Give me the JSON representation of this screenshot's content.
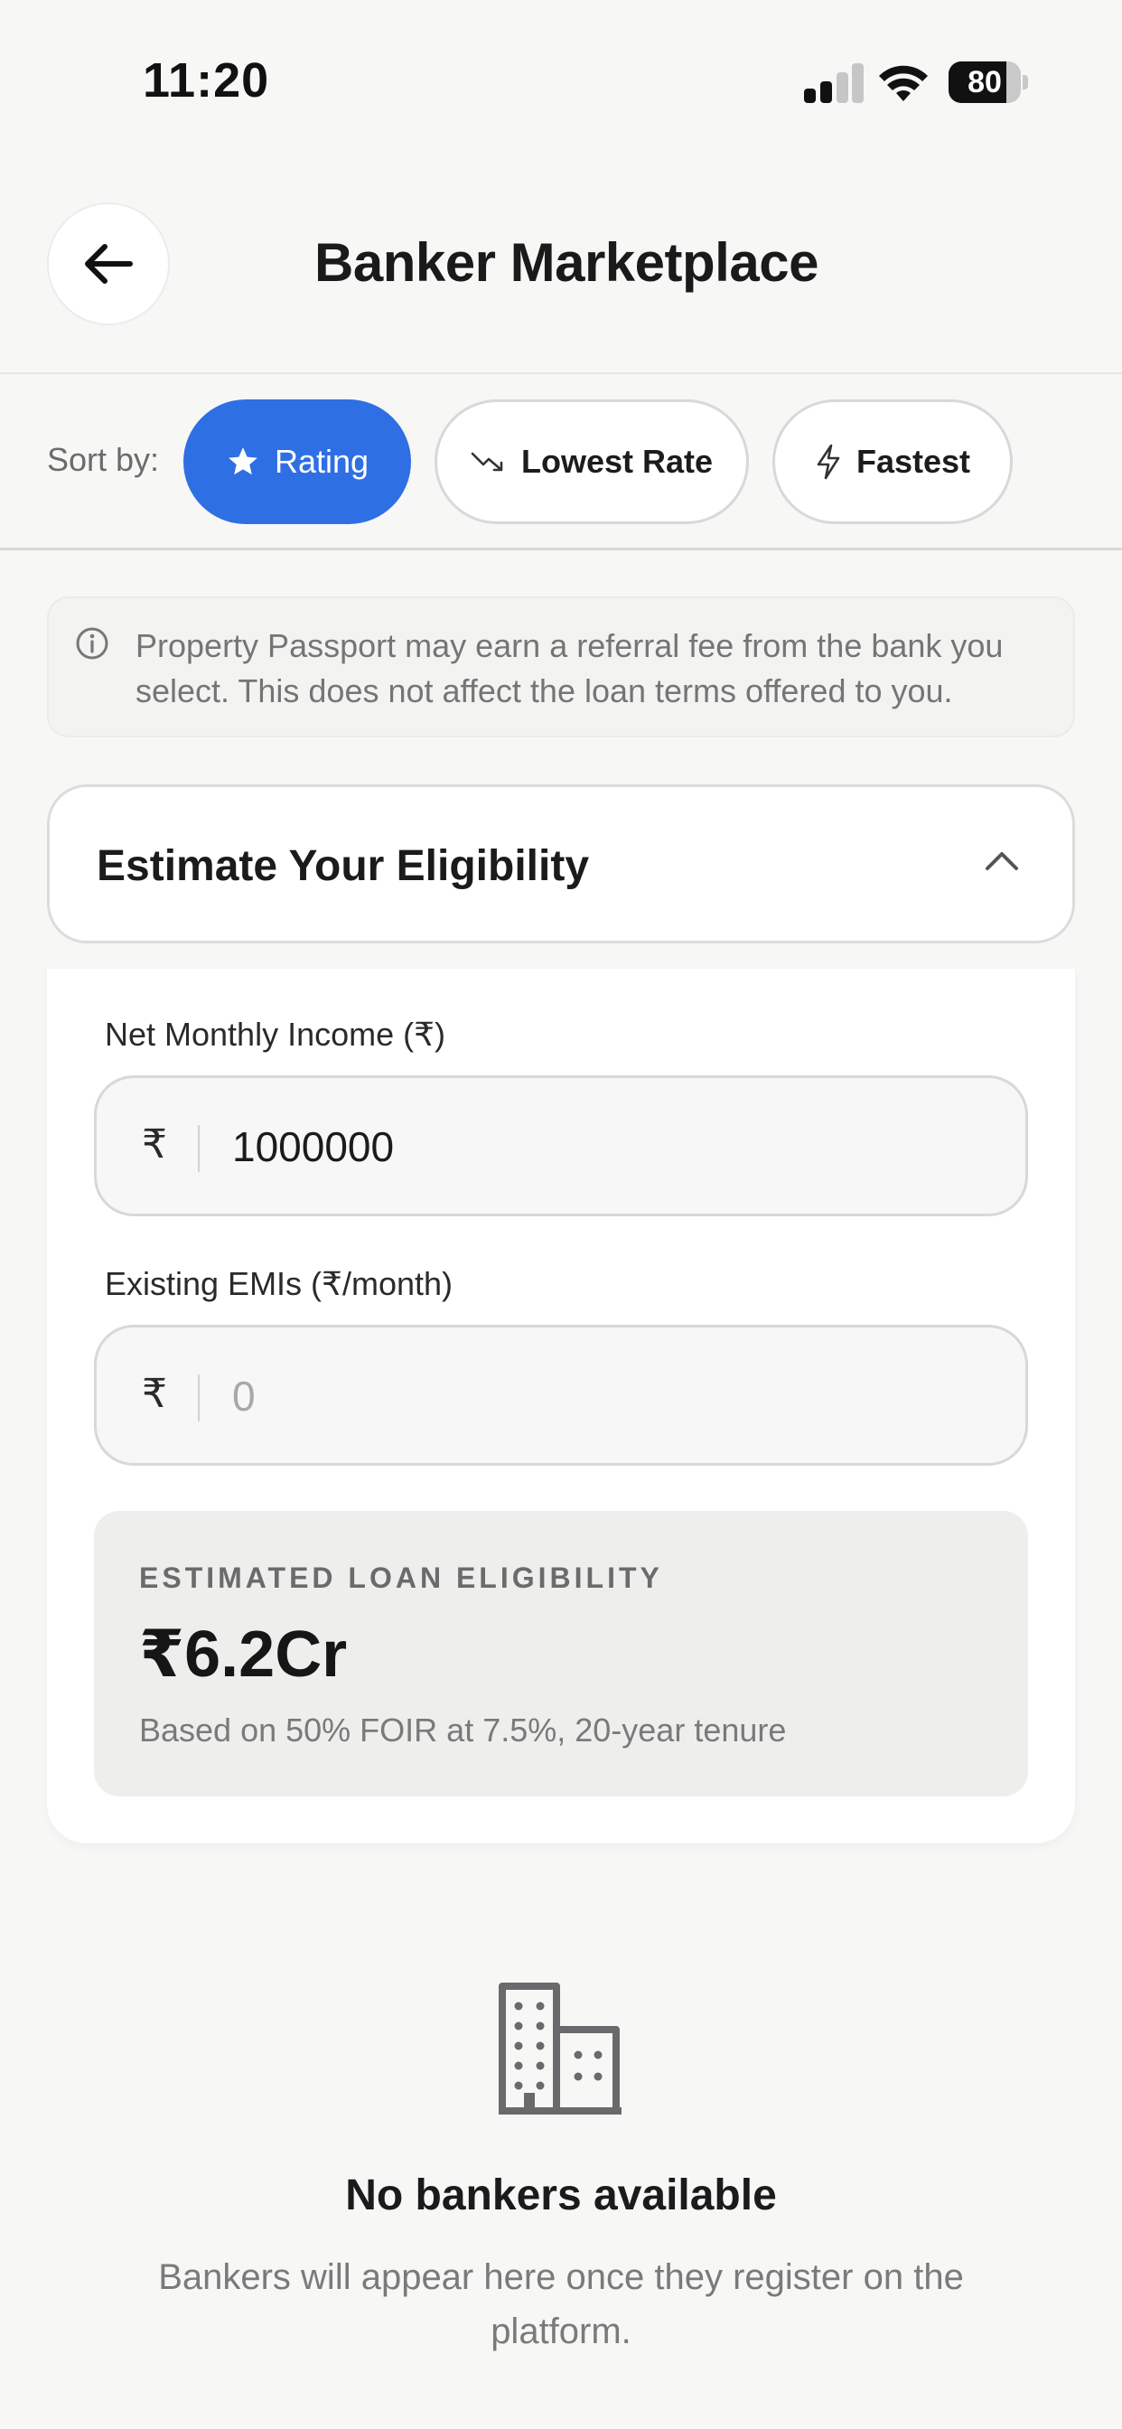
{
  "status_bar": {
    "time": "11:20",
    "battery": "80",
    "battery_level": 0.8
  },
  "header": {
    "title": "Banker Marketplace",
    "back_icon": "arrow-left-icon"
  },
  "sort": {
    "label": "Sort by:",
    "options": [
      {
        "label": "Rating",
        "icon": "star-icon",
        "active": true
      },
      {
        "label": "Lowest Rate",
        "icon": "trending-down-icon",
        "active": false
      },
      {
        "label": "Fastest",
        "icon": "lightning-icon",
        "active": false
      }
    ]
  },
  "disclaimer": {
    "icon": "info-icon",
    "text": "Property Passport may earn a referral fee from the bank you select. This does not affect the loan terms offered to you."
  },
  "eligibility": {
    "title": "Estimate Your Eligibility",
    "expanded": true,
    "income_label": "Net Monthly Income (₹)",
    "income_prefix": "₹",
    "income_value": "1000000",
    "emi_label": "Existing EMIs (₹/month)",
    "emi_prefix": "₹",
    "emi_placeholder": "0",
    "result_label": "ESTIMATED LOAN ELIGIBILITY",
    "result_value": "₹6.2Cr",
    "result_note": "Based on 50% FOIR at 7.5%, 20-year tenure"
  },
  "empty_state": {
    "icon": "building-icon",
    "title": "No bankers available",
    "description": "Bankers will appear here once they register on the platform."
  },
  "colors": {
    "accent": "#2f6fe4",
    "background": "#f7f7f6"
  }
}
